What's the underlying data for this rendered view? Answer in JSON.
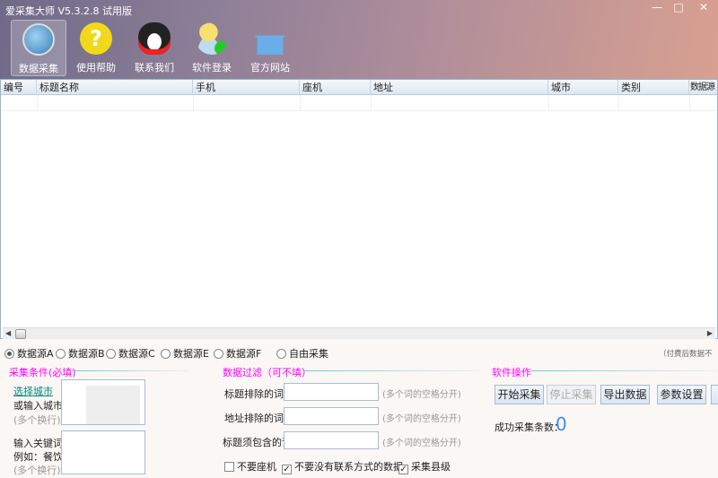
{
  "window": {
    "title": "爱采集大师 V5.3.2.8 试用版",
    "minimize": "—",
    "maximize": "□",
    "close": "✕"
  },
  "toolbar": [
    {
      "label": "数据采集",
      "icon": "globe-icon",
      "color": "#4a90c8"
    },
    {
      "label": "使用帮助",
      "icon": "help-icon",
      "color": "#f2d81a"
    },
    {
      "label": "联系我们",
      "icon": "qq-penguin-icon",
      "color": "#222222"
    },
    {
      "label": "软件登录",
      "icon": "user-login-icon",
      "color": "#f2c83a"
    },
    {
      "label": "官方网站",
      "icon": "home-icon",
      "color": "#6aaee8"
    }
  ],
  "table": {
    "columns": [
      "编号",
      "标题名称",
      "手机",
      "座机",
      "地址",
      "城市",
      "类别",
      "数据源"
    ]
  },
  "sources": {
    "options": [
      "数据源A",
      "数据源B",
      "数据源C",
      "数据源E",
      "数据源F",
      "自由采集"
    ],
    "selected": "数据源A",
    "note": "（付费后数据不"
  },
  "conditions": {
    "title": "采集条件(必填)",
    "select_city": "选择城市",
    "or_input_city": "或输入城市",
    "multi_line": "(多个换行)",
    "keyword_label": "输入关键词",
    "keyword_example": "例如：餐饮",
    "multi_line2": "(多个换行)"
  },
  "filter": {
    "title": "数据过滤（可不填）",
    "fields": [
      {
        "label": "标题排除的词",
        "value": "",
        "hint": "(多个词的空格分开)"
      },
      {
        "label": "地址排除的词",
        "value": "",
        "hint": "(多个词的空格分开)"
      },
      {
        "label": "标题须包含的词",
        "value": "",
        "hint": "(多个词的空格分开)"
      }
    ],
    "checkboxes": [
      {
        "label": "不要座机",
        "checked": false
      },
      {
        "label": "不要没有联系方式的数据",
        "checked": true
      },
      {
        "label": "采集县级",
        "checked": true
      }
    ]
  },
  "operations": {
    "title": "软件操作",
    "buttons": [
      "开始采集",
      "停止采集",
      "导出数据",
      "参数设置"
    ],
    "success_label": "成功采集条数：",
    "success_count": "0"
  }
}
